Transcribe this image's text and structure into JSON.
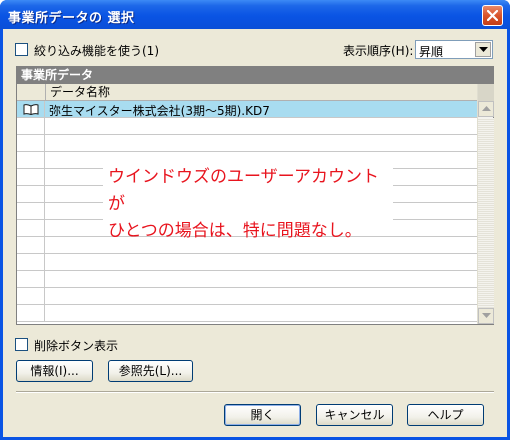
{
  "window": {
    "title": "事業所データの 選択"
  },
  "filter": {
    "label": "絞り込み機能を使う(1)",
    "checked": false
  },
  "sort": {
    "label": "表示順序(H):",
    "selected": "昇順"
  },
  "grid": {
    "header": "事業所データ",
    "column": "データ名称",
    "rows": [
      {
        "icon": "book-icon",
        "name": "弥生マイスター株式会社(3期〜5期).KD7",
        "selected": true
      }
    ],
    "selected_color": "#a8dcf0"
  },
  "annotation": {
    "line1": "ウインドウズのユーザーアカウントが",
    "line2": "ひとつの場合は、特に問題なし。",
    "color": "#e8141e"
  },
  "delete_toggle": {
    "label": "削除ボタン表示",
    "checked": false
  },
  "buttons": {
    "info": "情報(I)...",
    "reference": "参照先(L)...",
    "open": "開く",
    "cancel": "キャンセル",
    "help": "ヘルプ"
  }
}
